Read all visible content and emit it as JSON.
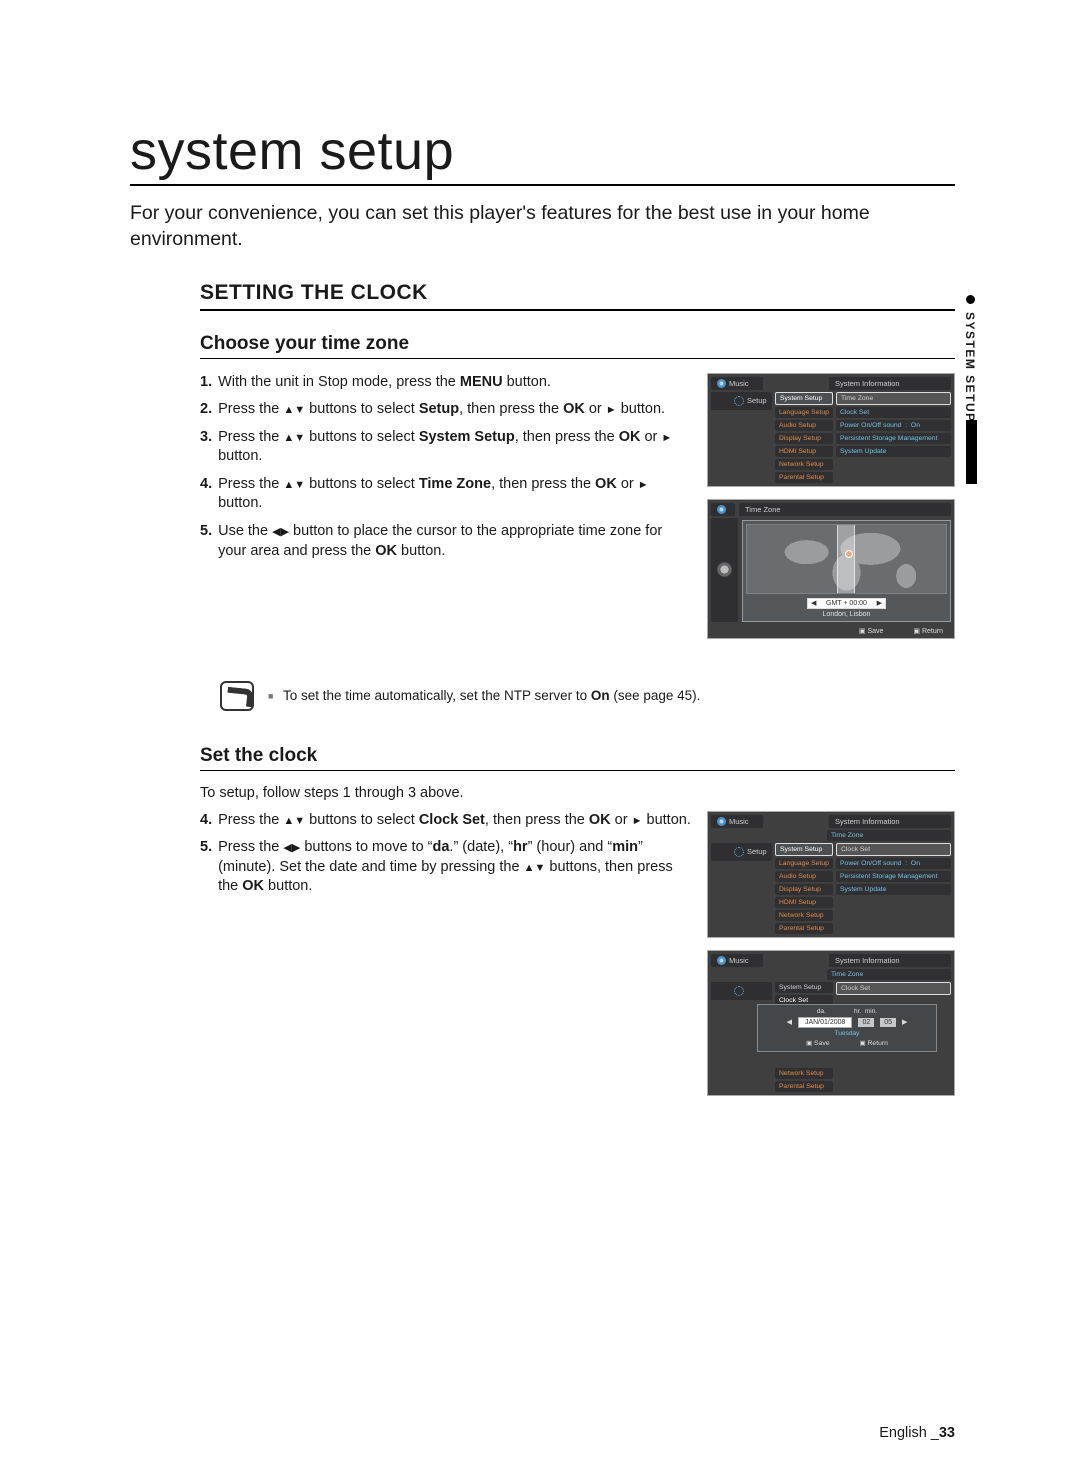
{
  "page": {
    "title": "system setup",
    "intro": "For your convenience, you can set this player's features for the best use in your home environment.",
    "footer_lang": "English",
    "footer_page": "33",
    "side_tab": "SYSTEM SETUP"
  },
  "s1": {
    "h1": "SETTING THE CLOCK",
    "h2a": "Choose your time zone",
    "steps_a": {
      "n1": "1.",
      "t1a": "With the unit in Stop mode, press the ",
      "t1b": "MENU",
      "t1c": " button.",
      "n2": "2.",
      "t2a": "Press the ",
      "t2b": " buttons to select ",
      "t2c": "Setup",
      "t2d": ", then press the ",
      "t2e": "OK",
      "t2f": " or ",
      "t2g": " button.",
      "n3": "3.",
      "t3a": "Press the ",
      "t3b": " buttons to select ",
      "t3c": "System Setup",
      "t3d": ", then press the ",
      "t3e": "OK",
      "t3f": " or ",
      "t3g": " button.",
      "n4": "4.",
      "t4a": "Press the ",
      "t4b": " buttons to select ",
      "t4c": "Time Zone",
      "t4d": ", then press the ",
      "t4e": "OK",
      "t4f": " or ",
      "t4g": " button.",
      "n5": "5.",
      "t5a": "Use the ",
      "t5b": " button to place the cursor to the appropriate time zone for your area and press the ",
      "t5c": "OK",
      "t5d": " button."
    },
    "note_a": "To set the time automatically, set the NTP server to ",
    "note_b": "On",
    "note_c": " (see page 45).",
    "h2b": "Set the clock",
    "lead_b": "To setup, follow steps 1 through 3 above.",
    "steps_b": {
      "n4": "4.",
      "t4a": "Press the ",
      "t4b": " buttons to select ",
      "t4c": "Clock Set",
      "t4d": ", then press the ",
      "t4e": "OK",
      "t4f": " or ",
      "t4g": " button.",
      "n5": "5.",
      "t5a": "Press the ",
      "t5b": " buttons to move to “",
      "t5c": "da",
      "t5d": ".” (date), “",
      "t5e": "hr",
      "t5f": "” (hour) and “",
      "t5g": "min",
      "t5h": "” (minute). Set the date and time by pressing the ",
      "t5i": " buttons, then press the ",
      "t5j": "OK",
      "t5k": " button."
    }
  },
  "ui": {
    "music": "Music",
    "setup": "Setup",
    "sys_info": "System Information",
    "time_zone": "Time Zone",
    "clock_set": "Clock Set",
    "power_sound": "Power On/Off sound",
    "on": "On",
    "psm": "Persistent Storage Management",
    "sys_update": "System Update",
    "menu": {
      "system_setup": "System Setup",
      "language_setup": "Language Setup",
      "audio_setup": "Audio Setup",
      "display_setup": "Display Setup",
      "hdmi_setup": "HDMI Setup",
      "network_setup": "Network Setup",
      "parental_setup": "Parental Setup"
    },
    "gmt": "GMT + 00:00",
    "city": "London, Lisbon",
    "save": "Save",
    "return": "Return",
    "da": "da.",
    "hr": "hr.",
    "min": "min.",
    "date_val": "JAN/01/2008",
    "hr_val": "02",
    "min_val": "05",
    "day": "Tuesday"
  }
}
